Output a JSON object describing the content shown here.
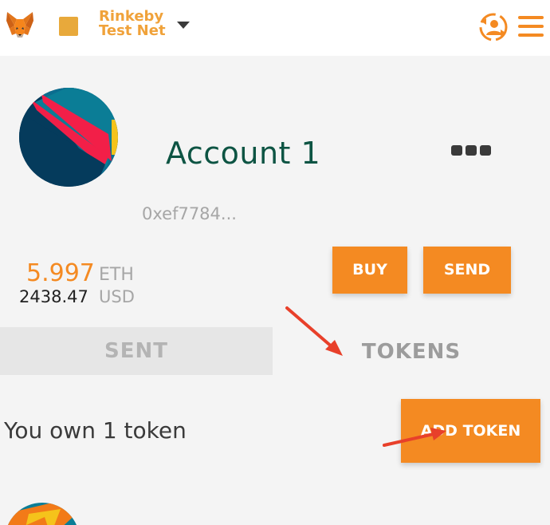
{
  "header": {
    "network_line1": "Rinkeby",
    "network_line2": "Test Net",
    "network_color": "#e8a93b",
    "icons": [
      "metamask-fox-icon",
      "network-dropdown-caret-icon",
      "account-switch-icon",
      "hamburger-menu-icon"
    ]
  },
  "account": {
    "name": "Account 1",
    "address": "0xef7784...",
    "options_icon": "more-dots-icon"
  },
  "balance": {
    "eth_amount": "5.997",
    "eth_unit": "ETH",
    "usd_amount": "2438.47",
    "usd_unit": "USD"
  },
  "actions": {
    "buy_label": "BUY",
    "send_label": "SEND"
  },
  "tabs": [
    {
      "label": "SENT",
      "active": false
    },
    {
      "label": "TOKENS",
      "active": true
    }
  ],
  "tokens": {
    "summary": "You own 1 token",
    "add_label": "ADD TOKEN"
  },
  "colors": {
    "accent": "#f48a22",
    "account_name": "#0d5443",
    "annotation_arrow": "#e8402a"
  }
}
